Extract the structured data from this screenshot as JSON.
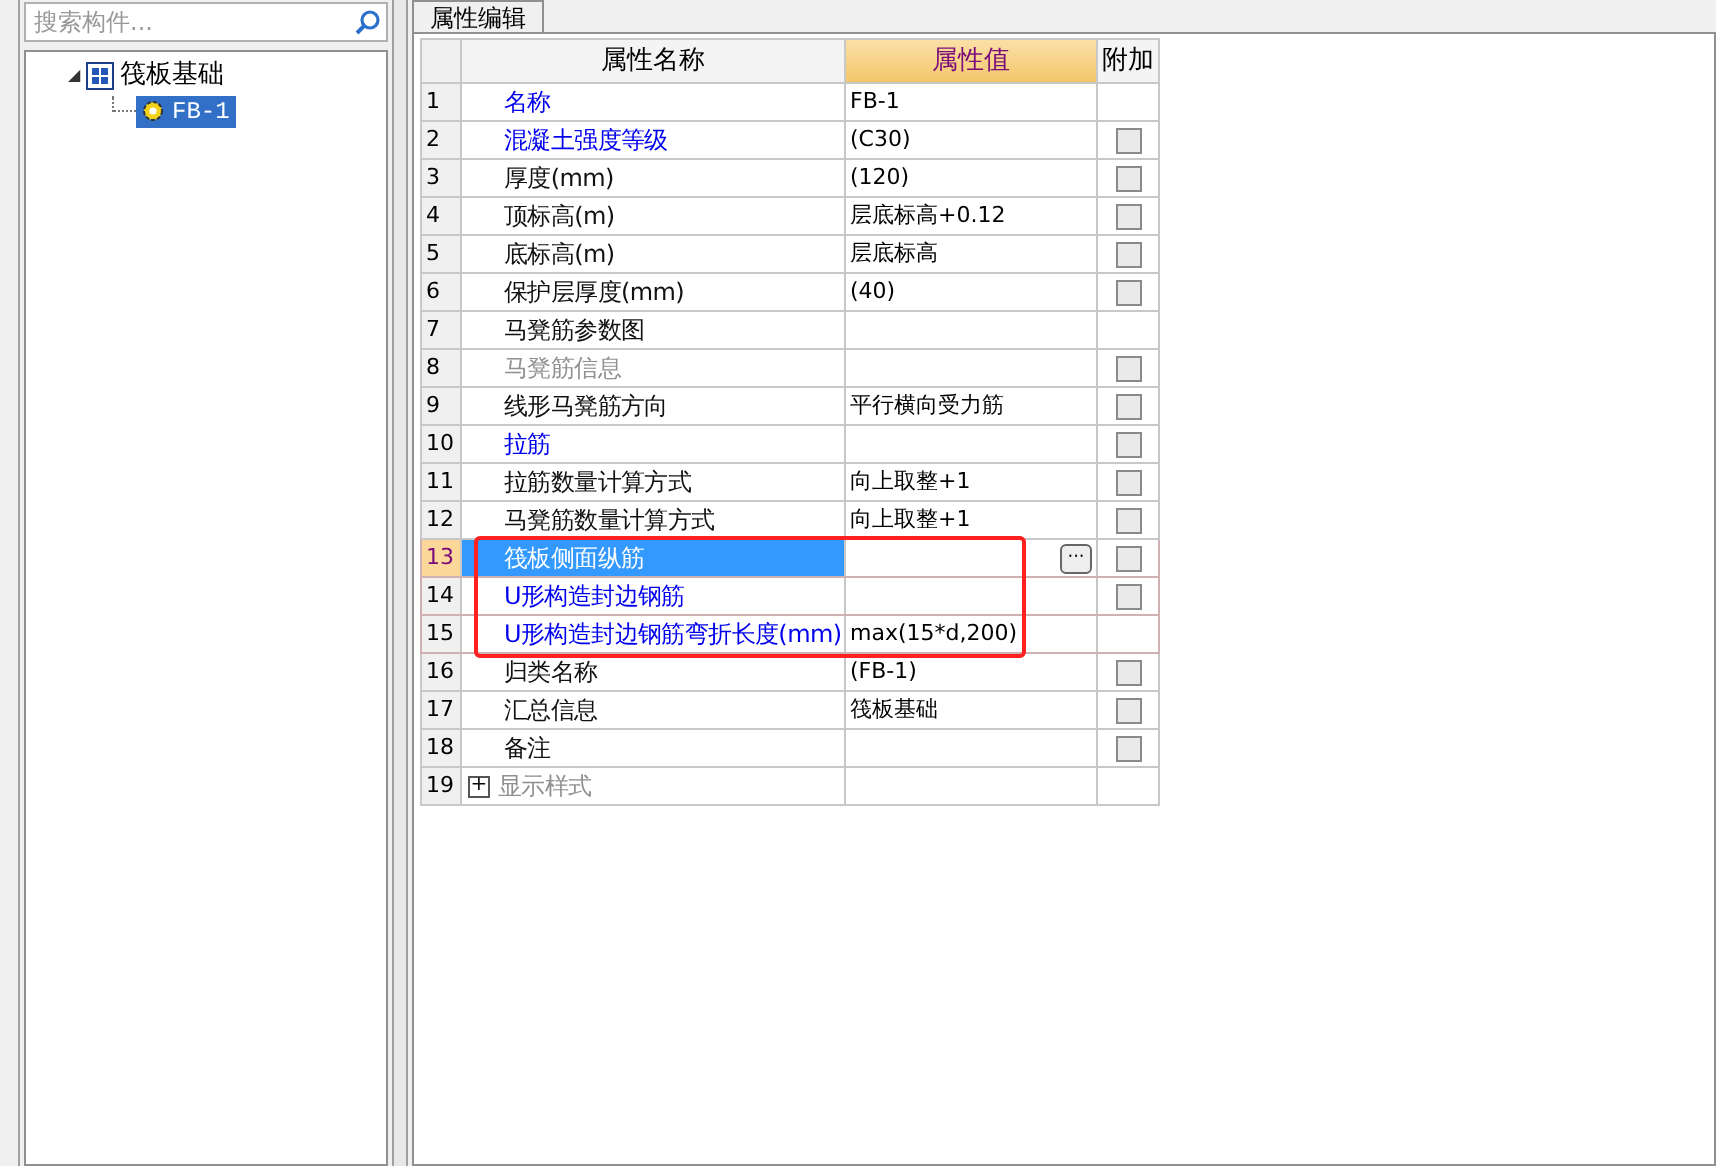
{
  "search": {
    "placeholder": "搜索构件..."
  },
  "tree": [
    {
      "label": "筏板基础",
      "expander": "◢",
      "expanded": true,
      "children": [
        {
          "label": "FB-1",
          "selected": true
        }
      ]
    }
  ],
  "tab": {
    "label": "属性编辑"
  },
  "table": {
    "columns": [
      "属性名称",
      "属性值",
      "附加"
    ],
    "rows": [
      {
        "no": "1",
        "name": "名称",
        "kind": "link",
        "value": "FB-1",
        "selected": false,
        "highlighted": false
      },
      {
        "no": "2",
        "name": "混凝土强度等级",
        "kind": "link",
        "value": "(C30)",
        "checked": false,
        "selected": false,
        "highlighted": false
      },
      {
        "no": "3",
        "name": "厚度(mm)",
        "kind": "plain",
        "value": "(120)",
        "checked": false,
        "selected": false,
        "highlighted": false
      },
      {
        "no": "4",
        "name": "顶标高(m)",
        "kind": "plain",
        "value": "层底标高+0.12",
        "checked": false,
        "selected": false,
        "highlighted": false
      },
      {
        "no": "5",
        "name": "底标高(m)",
        "kind": "plain",
        "value": "层底标高",
        "checked": false,
        "selected": false,
        "highlighted": false
      },
      {
        "no": "6",
        "name": "保护层厚度(mm)",
        "kind": "plain",
        "value": "(40)",
        "checked": false,
        "selected": false,
        "highlighted": false
      },
      {
        "no": "7",
        "name": "马凳筋参数图",
        "kind": "plain",
        "selected": false,
        "highlighted": false
      },
      {
        "no": "8",
        "name": "马凳筋信息",
        "kind": "disabled",
        "checked": false,
        "selected": false,
        "highlighted": false
      },
      {
        "no": "9",
        "name": "线形马凳筋方向",
        "kind": "plain",
        "value": "平行横向受力筋",
        "checked": false,
        "selected": false,
        "highlighted": false
      },
      {
        "no": "10",
        "name": "拉筋",
        "kind": "link",
        "checked": false,
        "selected": false,
        "highlighted": false
      },
      {
        "no": "11",
        "name": "拉筋数量计算方式",
        "kind": "plain",
        "value": "向上取整+1",
        "checked": false,
        "selected": false,
        "highlighted": false
      },
      {
        "no": "12",
        "name": "马凳筋数量计算方式",
        "kind": "plain",
        "value": "向上取整+1",
        "checked": false,
        "selected": false,
        "highlighted": false
      },
      {
        "no": "13",
        "name": "筏板侧面纵筋",
        "kind": "link",
        "ellipsis": "···",
        "checked": false,
        "selected": true,
        "highlighted": true
      },
      {
        "no": "14",
        "name": "U形构造封边钢筋",
        "kind": "link",
        "checked": false,
        "selected": false,
        "highlighted": true
      },
      {
        "no": "15",
        "name": "U形构造封边钢筋弯折长度(mm)",
        "kind": "link",
        "value": "max(15*d,200)",
        "selected": false,
        "highlighted": true
      },
      {
        "no": "16",
        "name": "归类名称",
        "kind": "plain",
        "value": "(FB-1)",
        "checked": false,
        "selected": false,
        "highlighted": false
      },
      {
        "no": "17",
        "name": "汇总信息",
        "kind": "plain",
        "value": "筏板基础",
        "checked": false,
        "selected": false,
        "highlighted": false
      },
      {
        "no": "18",
        "name": "备注",
        "kind": "plain",
        "checked": false,
        "selected": false,
        "highlighted": false
      },
      {
        "no": "19",
        "name": "显示样式",
        "kind": "disabled",
        "expand": "+",
        "selected": false,
        "highlighted": false
      }
    ]
  }
}
